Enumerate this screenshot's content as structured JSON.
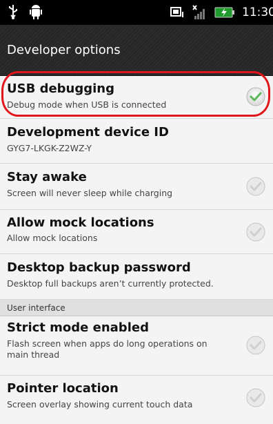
{
  "status_bar": {
    "time": "11:30",
    "icons": [
      "usb-icon",
      "debug-android-icon",
      "notification-icon",
      "signal-icon",
      "battery-icon"
    ]
  },
  "header": {
    "title": "Developer options"
  },
  "items": [
    {
      "title": "USB debugging",
      "summary": "Debug mode when USB is connected",
      "checked": true
    },
    {
      "title": "Development device ID",
      "summary": "GYG7-LKGK-Z2WZ-Y"
    },
    {
      "title": "Stay awake",
      "summary": "Screen will never sleep while charging",
      "checked": false
    },
    {
      "title": "Allow mock locations",
      "summary": "Allow mock locations",
      "checked": false
    },
    {
      "title": "Desktop backup password",
      "summary": "Desktop full backups aren’t currently protected."
    }
  ],
  "section": {
    "label": "User interface"
  },
  "items2": [
    {
      "title": "Strict mode enabled",
      "summary_line1": "Flash screen when apps do long operations on",
      "summary_line2": "main thread",
      "checked": false
    },
    {
      "title": "Pointer location",
      "summary": "Screen overlay showing current touch data",
      "checked": false
    }
  ],
  "colors": {
    "highlight": "#e0161c",
    "check_active": "#5cb85c",
    "header_bg": "#2a2a2a"
  }
}
